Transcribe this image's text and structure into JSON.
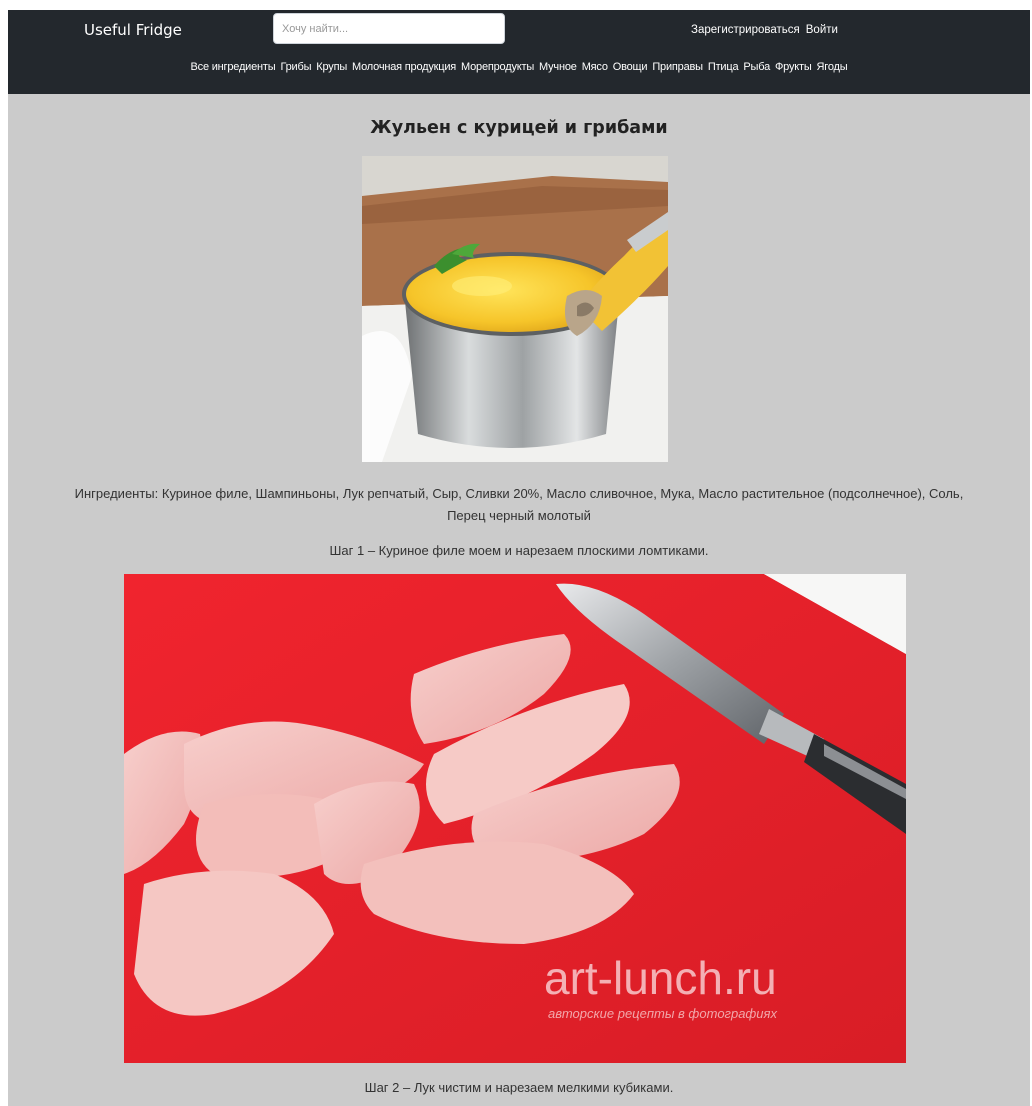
{
  "header": {
    "brand": "Useful Fridge",
    "search_placeholder": "Хочу найти...",
    "register_label": "Зарегистрироваться",
    "login_label": "Войти"
  },
  "categories": [
    "Все ингредиенты",
    "Грибы",
    "Крупы",
    "Молочная продукция",
    "Морепродукты",
    "Мучное",
    "Мясо",
    "Овощи",
    "Приправы",
    "Птица",
    "Рыба",
    "Фрукты",
    "Ягоды"
  ],
  "recipe": {
    "title": "Жульен с курицей и грибами",
    "ingredients_text": "Ингредиенты: Куриное филе, Шампиньоны, Лук репчатый, Сыр, Сливки 20%, Масло сливочное, Мука, Масло растительное (подсолнечное), Соль, Перец черный молотый",
    "steps": [
      {
        "text": "Шаг 1 – Куриное филе моем и нарезаем плоскими ломтиками."
      },
      {
        "text": "Шаг 2 – Лук чистим и нарезаем мелкими кубиками."
      }
    ],
    "watermark": {
      "line1": "art-lunch.ru",
      "line2": "авторские рецепты в фотографиях"
    }
  },
  "colors": {
    "navbar": "#23282d",
    "page_bg": "#cbcbcb",
    "board_red": "#e8222b"
  }
}
